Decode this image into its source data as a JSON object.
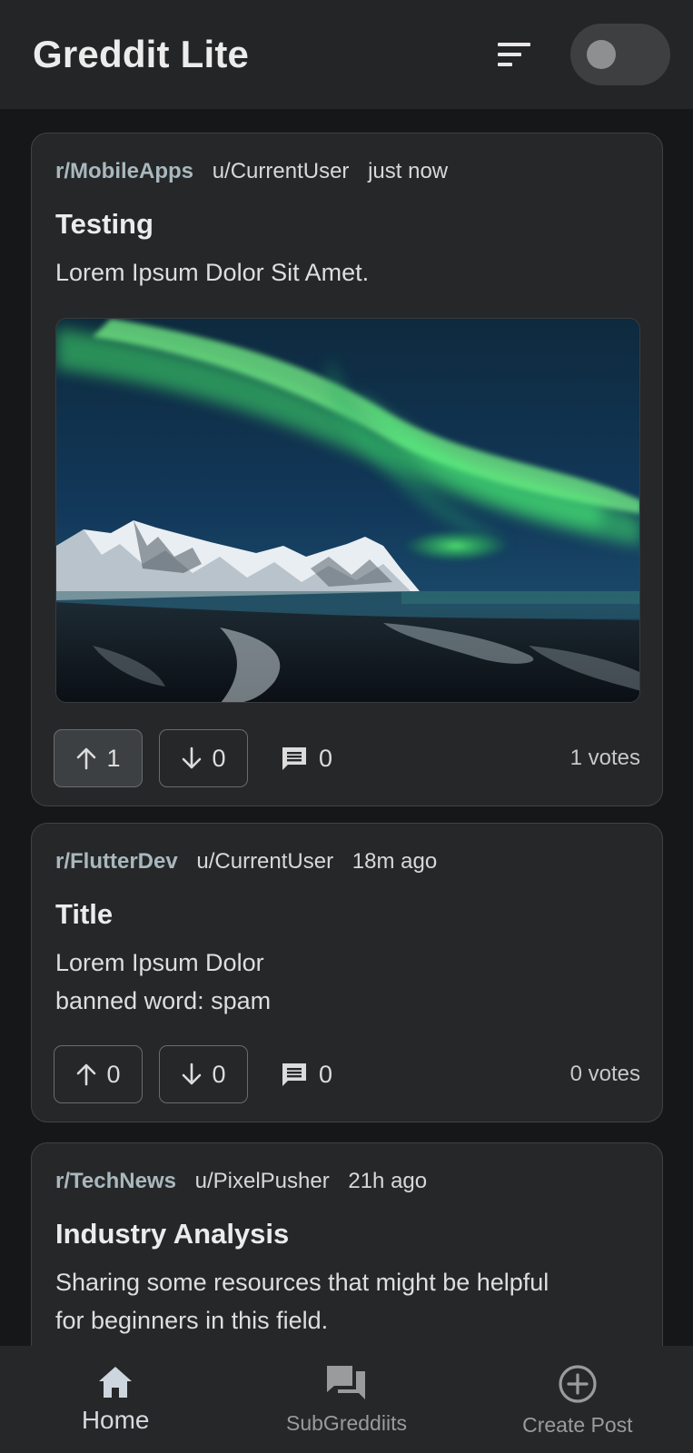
{
  "appbar": {
    "title": "Greddit Lite",
    "sort_icon": "sort-icon",
    "theme_toggle": "off"
  },
  "posts": [
    {
      "subreddit": "r/MobileApps",
      "user": "u/CurrentUser",
      "time": "just now",
      "title": "Testing",
      "body": "Lorem Ipsum Dolor Sit Amet.",
      "has_image": true,
      "image_icon": "aurora-landscape-image",
      "upvotes": "1",
      "downvotes": "0",
      "comments": "0",
      "votes_label": "1 votes",
      "upvote_active": true
    },
    {
      "subreddit": "r/FlutterDev",
      "user": "u/CurrentUser",
      "time": "18m ago",
      "title": "Title",
      "body_lines": [
        "Lorem Ipsum Dolor",
        "banned word: spam"
      ],
      "upvotes": "0",
      "downvotes": "0",
      "comments": "0",
      "votes_label": "0 votes",
      "upvote_active": false
    },
    {
      "subreddit": "r/TechNews",
      "user": "u/PixelPusher",
      "time": "21h ago",
      "title": "Industry Analysis",
      "body_lines": [
        "Sharing some resources that might be helpful",
        "for beginners in this field."
      ]
    }
  ],
  "bottom_nav": [
    {
      "label": "Home",
      "icon": "home-icon",
      "active": true
    },
    {
      "label": "SubGreddiits",
      "icon": "forum-icon",
      "active": false
    },
    {
      "label": "Create Post",
      "icon": "add-circle-icon",
      "active": false
    }
  ],
  "colors": {
    "background": "#161718",
    "surface": "#262728",
    "appbar": "#242527",
    "subreddit_text": "#a9b8be"
  }
}
